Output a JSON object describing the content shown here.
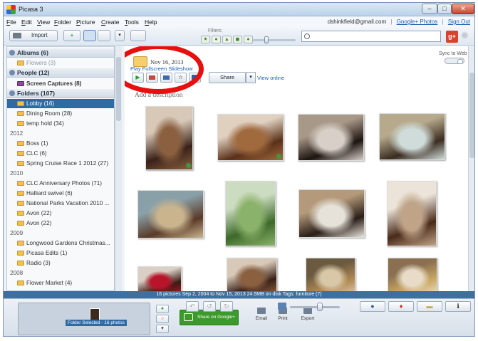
{
  "window": {
    "title": "Picasa 3",
    "min": "–",
    "max": "□",
    "close": "✕"
  },
  "menu": [
    "File",
    "Edit",
    "View",
    "Folder",
    "Picture",
    "Create",
    "Tools",
    "Help"
  ],
  "account": {
    "email": "dshinkfield@gmail.com",
    "photos_link": "Google+ Photos",
    "signout_link": "Sign Out",
    "separator": "|"
  },
  "toolbar": {
    "import_label": "Import",
    "add_label": "+",
    "dropdown": "▾",
    "filters_label": "Filters",
    "filter_glyphs": [
      "★",
      "●",
      "▲",
      "◼",
      "●"
    ],
    "search_placeholder": ""
  },
  "sidebar": {
    "albums": "Albums (6)",
    "flowers": "Flowers (3)",
    "people": "People (12)",
    "screen_captures": "Screen Captures (8)",
    "folders": "Folders (107)",
    "items": [
      {
        "label": "Lobby (16)",
        "selected": true
      },
      {
        "label": "Dining Room (28)"
      },
      {
        "label": "temp hold (34)"
      },
      {
        "year": "2012"
      },
      {
        "label": "Boss (1)"
      },
      {
        "label": "CLC (6)"
      },
      {
        "label": "Spring Cruise Race 1 2012 (27)"
      },
      {
        "year": "2010"
      },
      {
        "label": "CLC Anniversary Photos (71)"
      },
      {
        "label": "Halliard swivel (6)"
      },
      {
        "label": "National Parks Vacation 2010 ..."
      },
      {
        "label": "Avon (22)"
      },
      {
        "label": "Avon (22)"
      },
      {
        "year": "2009"
      },
      {
        "label": "Longwood Gardens Christmas..."
      },
      {
        "label": "Picasa Edits (1)"
      },
      {
        "label": "Radio (3)"
      },
      {
        "year": "2008"
      },
      {
        "label": "Flower Market (4)"
      }
    ]
  },
  "folder": {
    "date": "Nov 16, 2013",
    "slideshow_link": "Play Fullscreen Slideshow",
    "share_label": "Share",
    "share_dropdown": "▾",
    "view_online": "View online",
    "sync_label": "Sync to Web",
    "description_placeholder": "Add a description",
    "play_glyph": "▶"
  },
  "status_text": "16 pictures    Sep 2, 2004 to Nov 15, 2013    24.5MB on disk    Tags: furniture (7)",
  "tray": {
    "selection_label": "Folder Selected - 16 photos",
    "share_gplus": "Share on Google+",
    "email": "Email",
    "print": "Print",
    "export": "Export"
  },
  "colors": {
    "selection": "#2f6aa3",
    "status_bar": "#3d6fa0",
    "share_green": "#3c9a2b",
    "annotation_red": "#e8100f",
    "gplus_red": "#d8432e"
  },
  "thumbnails": [
    {
      "name": "photo-chair",
      "colors": [
        "#3a2118",
        "#8a6040",
        "#d8c8b8"
      ]
    },
    {
      "name": "photo-chest",
      "colors": [
        "#5a3018",
        "#a06a3e",
        "#e0d0c0"
      ]
    },
    {
      "name": "photo-sculpture",
      "colors": [
        "#1c1410",
        "#d8d0c8",
        "#a89888"
      ]
    },
    {
      "name": "photo-painting",
      "colors": [
        "#3a2c20",
        "#cfdcd9",
        "#b6a98c"
      ]
    },
    {
      "name": "photo-map",
      "colors": [
        "#5a3a28",
        "#c9b48e",
        "#8aa0a8"
      ]
    },
    {
      "name": "photo-tree",
      "colors": [
        "#3d6a2a",
        "#8bb26a",
        "#ccdcc0"
      ]
    },
    {
      "name": "photo-bird-print",
      "colors": [
        "#2a1e18",
        "#e6e2da",
        "#b49a7a"
      ]
    },
    {
      "name": "photo-hallway",
      "colors": [
        "#4a2a1a",
        "#bfa488",
        "#ece4d8"
      ]
    },
    {
      "name": "photo-flowers",
      "colors": [
        "#3a1a12",
        "#b8142a",
        "#d9cfc5"
      ]
    },
    {
      "name": "photo-chair-2",
      "colors": [
        "#3a2118",
        "#8a6040",
        "#d8c8b8"
      ]
    },
    {
      "name": "photo-mirror",
      "colors": [
        "#b08850",
        "#d8c8a8",
        "#6a5a40"
      ]
    },
    {
      "name": "photo-frame",
      "colors": [
        "#caa860",
        "#e8dcc8",
        "#8a7050"
      ]
    }
  ]
}
